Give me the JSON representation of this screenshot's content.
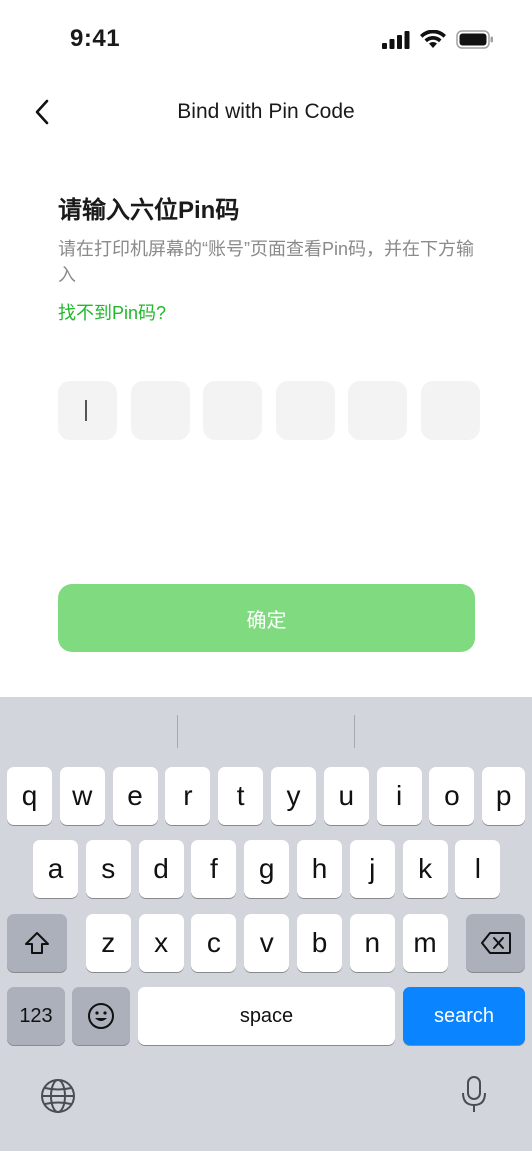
{
  "status": {
    "time": "9:41",
    "icons": [
      "cellular-signal-icon",
      "wifi-icon",
      "battery-icon"
    ]
  },
  "nav": {
    "back_icon": "chevron-left-icon",
    "title": "Bind with Pin Code"
  },
  "content": {
    "heading": "请输入六位Pin码",
    "description": "请在打印机屏幕的“账号”页面查看Pin码，并在下方输入",
    "help_link": "找不到Pin码?",
    "pin_boxes": [
      "",
      "",
      "",
      "",
      "",
      ""
    ],
    "confirm_label": "确定"
  },
  "colors": {
    "accent": "#22b82d",
    "confirm_bg": "#80da80",
    "key_blue": "#0a84ff",
    "keyboard_bg": "#d2d5db"
  },
  "keyboard": {
    "row1": [
      "q",
      "w",
      "e",
      "r",
      "t",
      "y",
      "u",
      "i",
      "o",
      "p"
    ],
    "row2": [
      "a",
      "s",
      "d",
      "f",
      "g",
      "h",
      "j",
      "k",
      "l"
    ],
    "row3": [
      "z",
      "x",
      "c",
      "v",
      "b",
      "n",
      "m"
    ],
    "shift_icon": "shift-icon",
    "delete_icon": "delete-icon",
    "numbers_label": "123",
    "emoji_icon": "emoji-icon",
    "space_label": "space",
    "search_label": "search",
    "globe_icon": "globe-icon",
    "mic_icon": "microphone-icon"
  }
}
